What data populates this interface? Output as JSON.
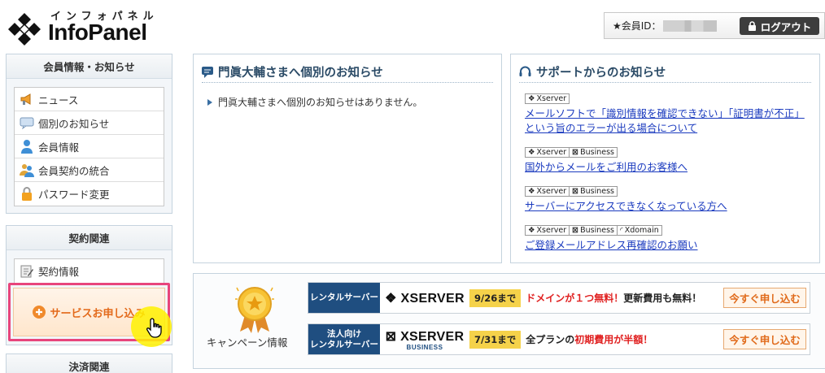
{
  "logo": {
    "kana": "インフォパネル",
    "text": "InfoPanel"
  },
  "member": {
    "id_label": "★会員ID："
  },
  "logout": {
    "label": "ログアウト"
  },
  "sidebar": {
    "sections": [
      {
        "title": "会員情報・お知らせ",
        "items": [
          {
            "label": "ニュース",
            "icon": "megaphone-icon"
          },
          {
            "label": "個別のお知らせ",
            "icon": "message-icon"
          },
          {
            "label": "会員情報",
            "icon": "user-icon"
          },
          {
            "label": "会員契約の統合",
            "icon": "users-merge-icon"
          },
          {
            "label": "パスワード変更",
            "icon": "lock-icon"
          }
        ]
      },
      {
        "title": "契約関連",
        "items": [
          {
            "label": "契約情報",
            "icon": "contract-icon"
          }
        ],
        "action": "サービスお申し込み"
      },
      {
        "title": "決済関連"
      }
    ]
  },
  "notice_panel": {
    "title": "門眞大輔さまへ個別のお知らせ",
    "message": "門眞大輔さまへ個別のお知らせはありません。"
  },
  "support_panel": {
    "title": "サポートからのお知らせ",
    "items": [
      {
        "tags": [
          "Xserver"
        ],
        "link": "メールソフトで「識別情報を確認できない」「証明書が不正」という旨のエラーが出る場合について"
      },
      {
        "tags": [
          "Xserver",
          "Business"
        ],
        "link": "国外からメールをご利用のお客様へ"
      },
      {
        "tags": [
          "Xserver",
          "Business"
        ],
        "link": "サーバーにアクセスできなくなっている方へ"
      },
      {
        "tags": [
          "Xserver",
          "Business",
          "Xdomain"
        ],
        "link": "ご登録メールアドレス再確認のお願い"
      }
    ]
  },
  "campaign": {
    "label": "キャンペーン情報",
    "banners": [
      {
        "category": "レンタルサーバー",
        "logo": "XSERVER",
        "logo_sub": "",
        "date": "9/26まで",
        "text_red": "ドメインが１つ無料！",
        "text_pre": "",
        "text_post": "更新費用も無料！",
        "cta": "今すぐ申し込む"
      },
      {
        "category_line1": "法人向け",
        "category_line2": "レンタルサーバー",
        "logo": "XSERVER",
        "logo_sub": "BUSINESS",
        "date": "7/31まで",
        "text_pre": "全プランの",
        "text_red": "初期費用が半額",
        "text_post": "！",
        "cta": "今すぐ申し込む"
      }
    ]
  },
  "colors": {
    "accent_blue": "#1f4e80",
    "highlight": "#e8457c",
    "orange": "#e36a1b",
    "link": "#1b3bbf"
  }
}
